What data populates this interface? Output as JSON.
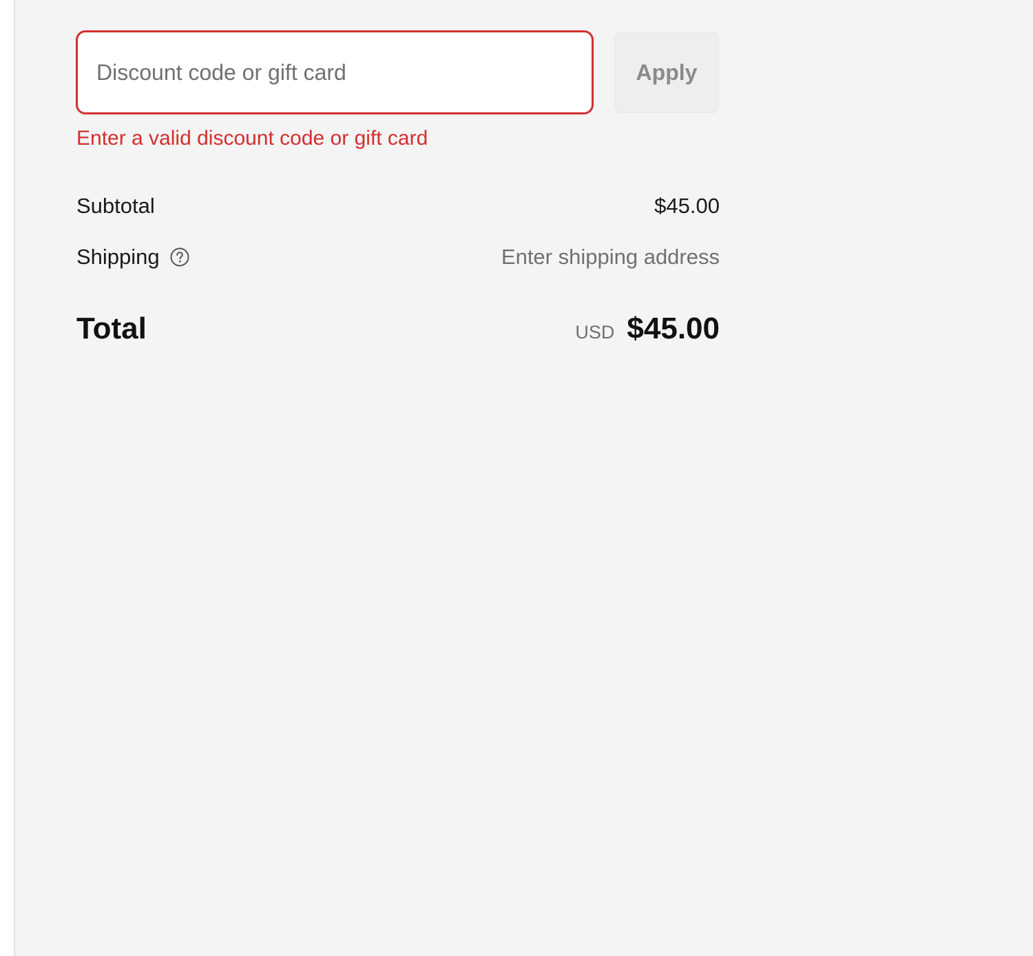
{
  "discount": {
    "placeholder": "Discount code or gift card",
    "value": "",
    "apply_label": "Apply",
    "error": "Enter a valid discount code or gift card"
  },
  "summary": {
    "subtotal_label": "Subtotal",
    "subtotal_value": "$45.00",
    "shipping_label": "Shipping",
    "shipping_value": "Enter shipping address",
    "total_label": "Total",
    "currency": "USD",
    "total_value": "$45.00"
  },
  "colors": {
    "error": "#d32f2f",
    "panel_background": "#f4f4f4",
    "muted_text": "#707070"
  },
  "icons": {
    "shipping_help": "question-circle-icon"
  }
}
